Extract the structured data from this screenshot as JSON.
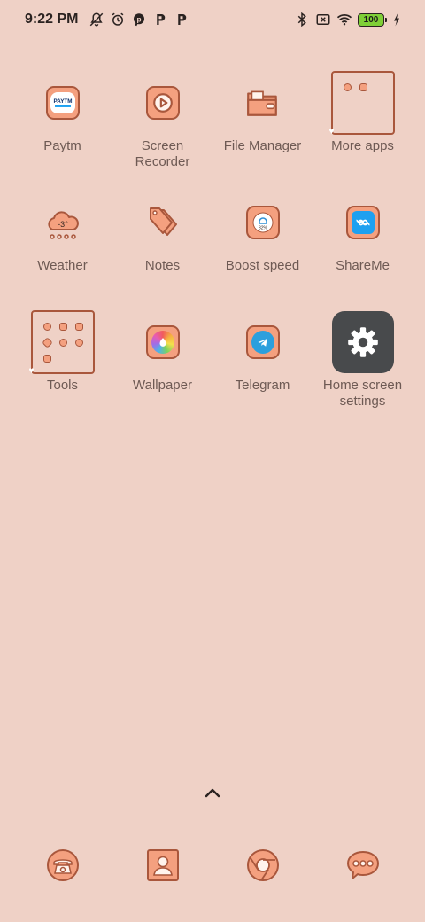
{
  "status_bar": {
    "time": "9:22 PM",
    "battery": "100",
    "icons": [
      "notifications-off-icon",
      "alarm-icon",
      "p-app-icon",
      "p-app-icon",
      "p-app-icon",
      "bluetooth-icon",
      "no-sim-icon",
      "wifi-icon",
      "battery-icon",
      "charging-icon"
    ]
  },
  "apps": [
    [
      {
        "label": "Paytm",
        "icon": "paytm-icon"
      },
      {
        "label": "Screen Recorder",
        "icon": "screen-recorder-icon"
      },
      {
        "label": "File Manager",
        "icon": "file-manager-icon"
      },
      {
        "label": "More apps",
        "icon": "folder-icon"
      }
    ],
    [
      {
        "label": "Weather",
        "icon": "weather-icon",
        "value": "-3°"
      },
      {
        "label": "Notes",
        "icon": "notes-icon"
      },
      {
        "label": "Boost speed",
        "icon": "boost-speed-icon",
        "value": "32%"
      },
      {
        "label": "ShareMe",
        "icon": "shareme-icon"
      }
    ],
    [
      {
        "label": "Tools",
        "icon": "folder-icon"
      },
      {
        "label": "Wallpaper",
        "icon": "wallpaper-icon"
      },
      {
        "label": "Telegram",
        "icon": "telegram-icon"
      },
      {
        "label": "Home screen settings",
        "icon": "settings-icon"
      }
    ]
  ],
  "dock": [
    "phone-icon",
    "contacts-icon",
    "browser-icon",
    "messages-icon"
  ],
  "colors": {
    "background": "#efd1c6",
    "icon_fill": "#f4a07f",
    "icon_stroke": "#a9573c",
    "label": "#6e5a54"
  }
}
